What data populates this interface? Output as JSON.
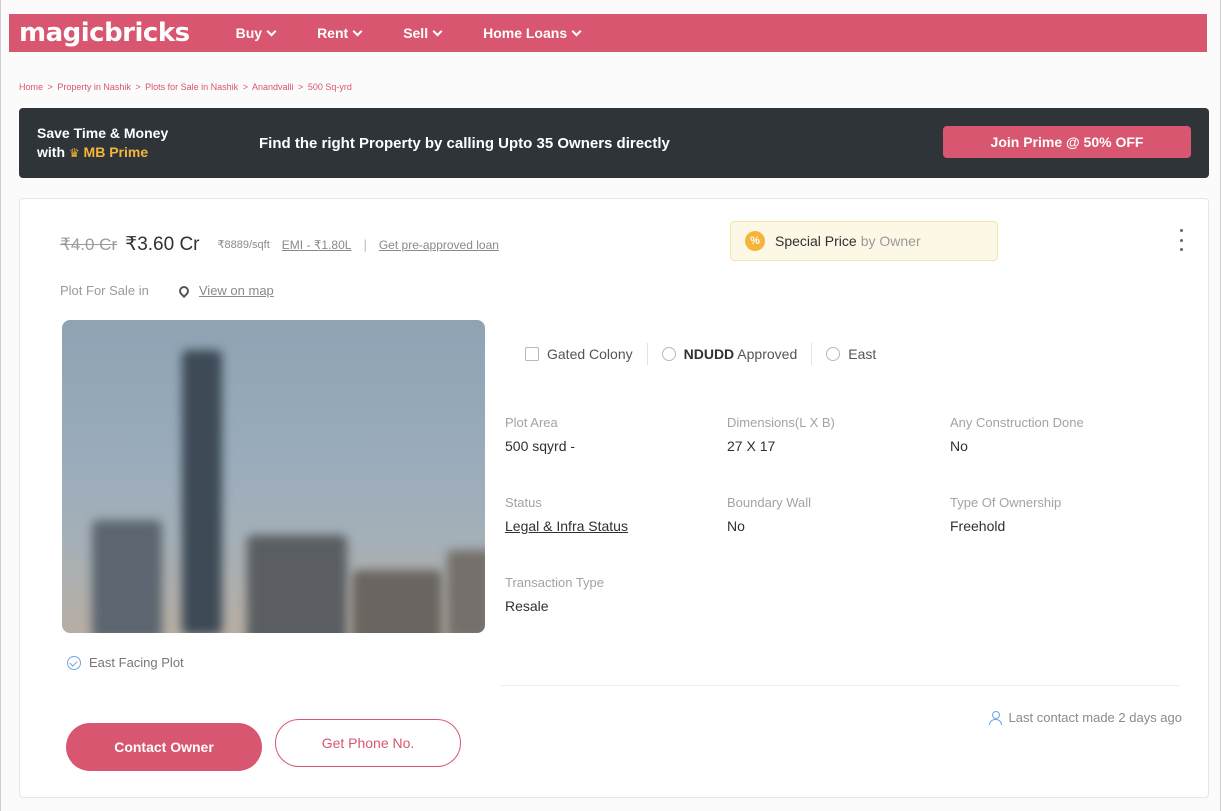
{
  "brand": {
    "logo": "magicbricks",
    "accent": "#d8566f",
    "dark": "#2f3439",
    "gold": "#f4b53a"
  },
  "nav": {
    "items": [
      {
        "label": "Buy"
      },
      {
        "label": "Rent"
      },
      {
        "label": "Sell"
      },
      {
        "label": "Home Loans"
      }
    ]
  },
  "breadcrumb": {
    "items": [
      "Home",
      "Property in Nashik",
      "Plots for Sale in Nashik",
      "Anandvalli",
      "500 Sq-yrd"
    ],
    "separator": ">"
  },
  "banner": {
    "line1": "Save Time & Money",
    "line2_prefix": "with",
    "line2_brand": "MB Prime",
    "message": "Find the right Property by calling Upto 35 Owners directly",
    "cta": "Join Prime @ 50% OFF"
  },
  "listing": {
    "old_price": "₹4.0 Cr",
    "price": "₹3.60 Cr",
    "price_per_sqft": "₹8889/sqft",
    "emi": "EMI - ₹1.80L",
    "divider": "|",
    "loan_link": "Get pre-approved loan",
    "special": {
      "icon_glyph": "%",
      "label": "Special Price",
      "suffix": "by Owner"
    },
    "subtitle": "Plot For Sale in",
    "map_link": "View on map",
    "tags": [
      {
        "label": "Gated Colony",
        "icon": "gated-colony-icon"
      },
      {
        "label_strong": "NDUDD",
        "label": "Approved",
        "icon": "approved-icon"
      },
      {
        "label": "East",
        "icon": "compass-icon"
      }
    ],
    "details": {
      "plot_area": {
        "key": "Plot Area",
        "value": "500 sqyrd -"
      },
      "dimensions": {
        "key": "Dimensions(L X B)",
        "value": "27 X 17"
      },
      "construction": {
        "key": "Any Construction Done",
        "value": "No"
      },
      "status": {
        "key": "Status",
        "value": "Legal & Infra Status"
      },
      "boundary": {
        "key": "Boundary Wall",
        "value": "No"
      },
      "ownership": {
        "key": "Type Of Ownership",
        "value": "Freehold"
      },
      "transaction": {
        "key": "Transaction Type",
        "value": "Resale"
      }
    },
    "highlight": "East Facing Plot",
    "contact_button": "Contact Owner",
    "phone_button": "Get Phone No.",
    "last_contact": "Last contact made 2 days ago"
  }
}
